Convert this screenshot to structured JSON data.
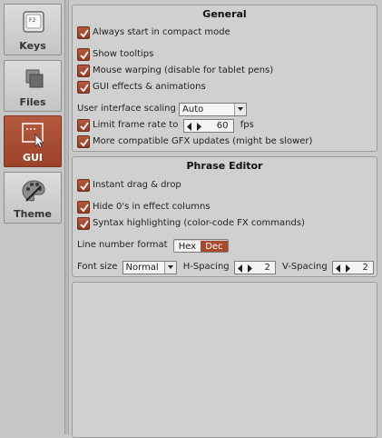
{
  "sidebar": {
    "tabs": [
      {
        "label": "Keys",
        "icon": "keyboard-key-icon",
        "active": false
      },
      {
        "label": "Files",
        "icon": "files-icon",
        "active": false
      },
      {
        "label": "GUI",
        "icon": "gui-window-icon",
        "active": true
      },
      {
        "label": "Theme",
        "icon": "palette-icon",
        "active": false
      }
    ],
    "keys_icon_text": "F2"
  },
  "general": {
    "title": "General",
    "always_compact": "Always start in compact mode",
    "show_tooltips": "Show tooltips",
    "mouse_warping": "Mouse warping (disable for tablet pens)",
    "gui_effects": "GUI effects & animations",
    "scaling_label": "User interface scaling",
    "scaling_value": "Auto",
    "limit_frame_label": "Limit frame rate to",
    "frame_rate_value": "60",
    "fps_label": "fps",
    "compatible_gfx": "More compatible GFX updates (might be slower)"
  },
  "phrase_editor": {
    "title": "Phrase Editor",
    "instant_drag": "Instant drag & drop",
    "hide_zeros": "Hide 0's in effect columns",
    "syntax_highlight": "Syntax highlighting (color-code FX commands)",
    "line_number_label": "Line number format",
    "hex_label": "Hex",
    "dec_label": "Dec",
    "selected_format": "Dec",
    "font_size_label": "Font size",
    "font_size_value": "Normal",
    "h_spacing_label": "H-Spacing",
    "h_spacing_value": "2",
    "v_spacing_label": "V-Spacing",
    "v_spacing_value": "2"
  },
  "colors": {
    "accent": "#a94a2f",
    "panel_bg": "#d0d0d0",
    "window_bg": "#c8c8c8"
  }
}
